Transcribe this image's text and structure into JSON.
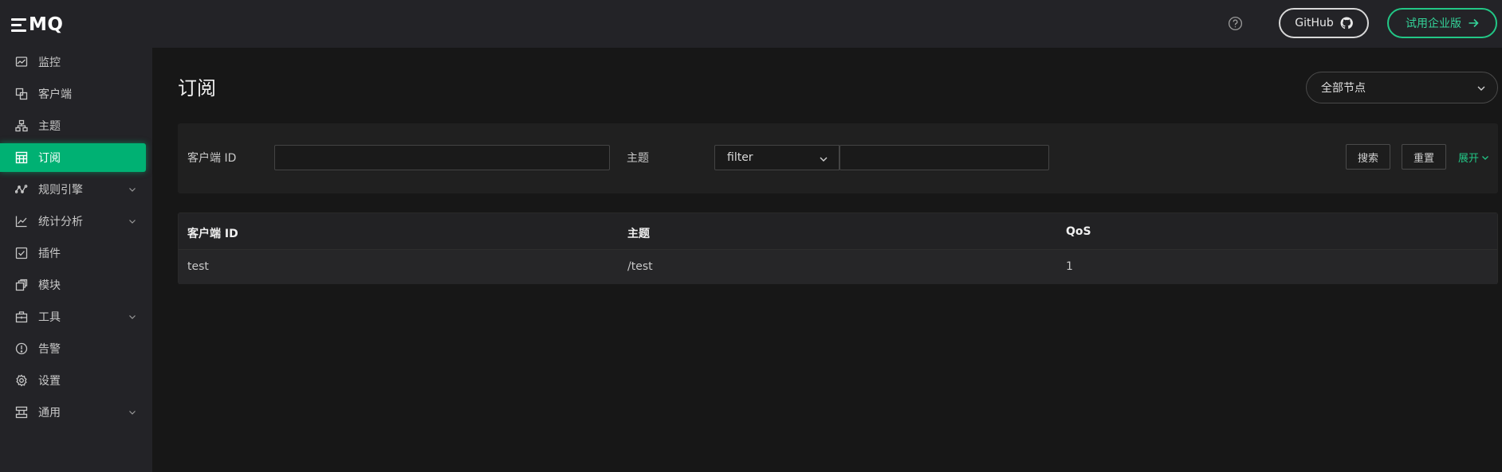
{
  "app": {
    "logo_text": "MQ"
  },
  "sidebar": {
    "items": [
      {
        "label": "监控",
        "icon": "monitor-icon",
        "expandable": false,
        "active": false
      },
      {
        "label": "客户端",
        "icon": "clients-icon",
        "expandable": false,
        "active": false
      },
      {
        "label": "主题",
        "icon": "topics-icon",
        "expandable": false,
        "active": false
      },
      {
        "label": "订阅",
        "icon": "subscriptions-icon",
        "expandable": false,
        "active": true
      },
      {
        "label": "规则引擎",
        "icon": "rule-engine-icon",
        "expandable": true,
        "active": false
      },
      {
        "label": "统计分析",
        "icon": "analytics-icon",
        "expandable": true,
        "active": false
      },
      {
        "label": "插件",
        "icon": "plugins-icon",
        "expandable": false,
        "active": false
      },
      {
        "label": "模块",
        "icon": "modules-icon",
        "expandable": false,
        "active": false
      },
      {
        "label": "工具",
        "icon": "tools-icon",
        "expandable": true,
        "active": false
      },
      {
        "label": "告警",
        "icon": "alarm-icon",
        "expandable": false,
        "active": false
      },
      {
        "label": "设置",
        "icon": "settings-icon",
        "expandable": false,
        "active": false
      },
      {
        "label": "通用",
        "icon": "general-icon",
        "expandable": true,
        "active": false
      }
    ]
  },
  "header": {
    "github_label": "GitHub",
    "enterprise_label": "试用企业版"
  },
  "page": {
    "title": "订阅",
    "node_select": "全部节点"
  },
  "filter": {
    "client_id_label": "客户端 ID",
    "client_id_value": "",
    "topic_label": "主题",
    "topic_match_select": "filter",
    "topic_value": "",
    "search_label": "搜索",
    "reset_label": "重置",
    "expand_label": "展开"
  },
  "table": {
    "columns": [
      "客户端 ID",
      "主题",
      "QoS"
    ],
    "rows": [
      [
        "test",
        "/test",
        "1"
      ]
    ]
  },
  "colors": {
    "accent": "#00b173",
    "accent_text": "#22c786",
    "sidebar_bg": "#232327",
    "page_bg": "#171717"
  }
}
